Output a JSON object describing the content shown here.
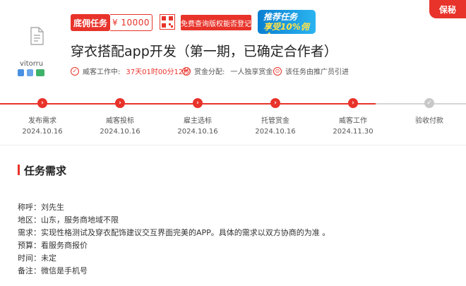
{
  "user": {
    "name": "vitorru"
  },
  "header": {
    "task_type": "底佣任务",
    "amount": "¥ 10000",
    "check_button": "免费查询版权能否登记",
    "promo_line1": "推荐任务",
    "promo_line2": "享受10%佣金",
    "corner": "保秘"
  },
  "title": "穿衣搭配app开发（第一期，已确定合作者）",
  "meta": {
    "work_label": "威客工作中:",
    "countdown": "37天01时00分12秒",
    "reward_label": "赏金分配:",
    "reward_value": "一人独享赏金",
    "source": "该任务由推广员引进"
  },
  "steps": [
    {
      "label": "发布需求",
      "date": "2024.10.16",
      "done": true
    },
    {
      "label": "威客投标",
      "date": "2024.10.16",
      "done": true
    },
    {
      "label": "雇主选标",
      "date": "2024.10.16",
      "done": true
    },
    {
      "label": "托管赏金",
      "date": "2024.10.16",
      "done": true
    },
    {
      "label": "威客工作",
      "date": "2024.11.30",
      "done": true
    },
    {
      "label": "验收付款",
      "date": "",
      "done": false
    }
  ],
  "section": {
    "title": "任务需求"
  },
  "requirements": [
    "称呼：刘先生",
    "地区：山东，服务商地域不限",
    "需求：实现性格测试及穿衣配饰建议交互界面完美的APP。具体的需求以双方协商的为准 。",
    "预算：看服务商报价",
    "时间：未定",
    "备注：微信是手机号"
  ],
  "colors": {
    "accent": "#e8332a",
    "pending": "#c8c8c8"
  }
}
